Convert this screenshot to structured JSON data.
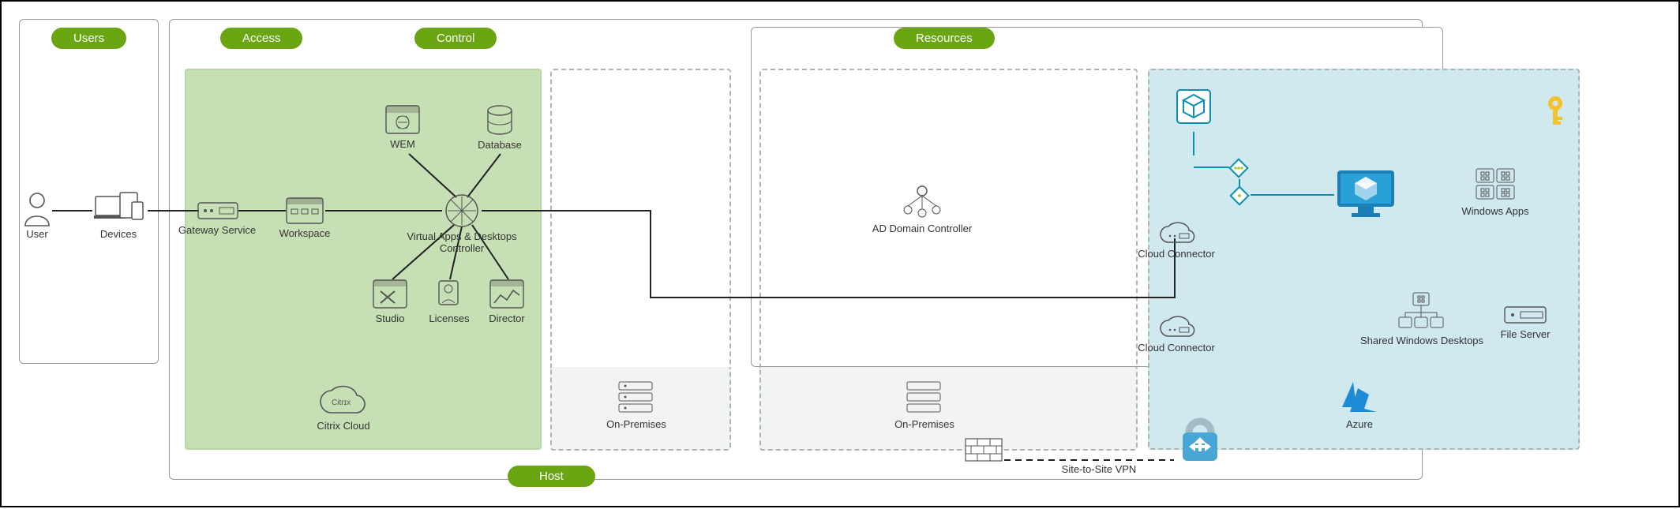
{
  "headers": {
    "users": "Users",
    "access": "Access",
    "control": "Control",
    "resources": "Resources",
    "host": "Host"
  },
  "users_block": {
    "user": "User",
    "devices": "Devices"
  },
  "access_block": {
    "gateway": "Gateway Service",
    "workspace": "Workspace",
    "controller_line1": "Virtual Apps & Desktops",
    "controller_line2": "Controller",
    "wem": "WEM",
    "database": "Database",
    "studio": "Studio",
    "licenses": "Licenses",
    "director": "Director",
    "citrix_cloud_icon_text": "Citrɪx",
    "citrix_cloud": "Citrix Cloud"
  },
  "control_block": {
    "on_prem": "On-Premises"
  },
  "resources_block": {
    "ad_dc": "AD Domain Controller",
    "cloud_connector": "Cloud Connector",
    "cloud_connector2": "Cloud Connector",
    "on_prem": "On-Premises",
    "site_to_site_vpn": "Site-to-Site VPN",
    "windows_apps": "Windows Apps",
    "shared_desktops": "Shared Windows Desktops",
    "file_server": "File Server",
    "azure": "Azure"
  }
}
